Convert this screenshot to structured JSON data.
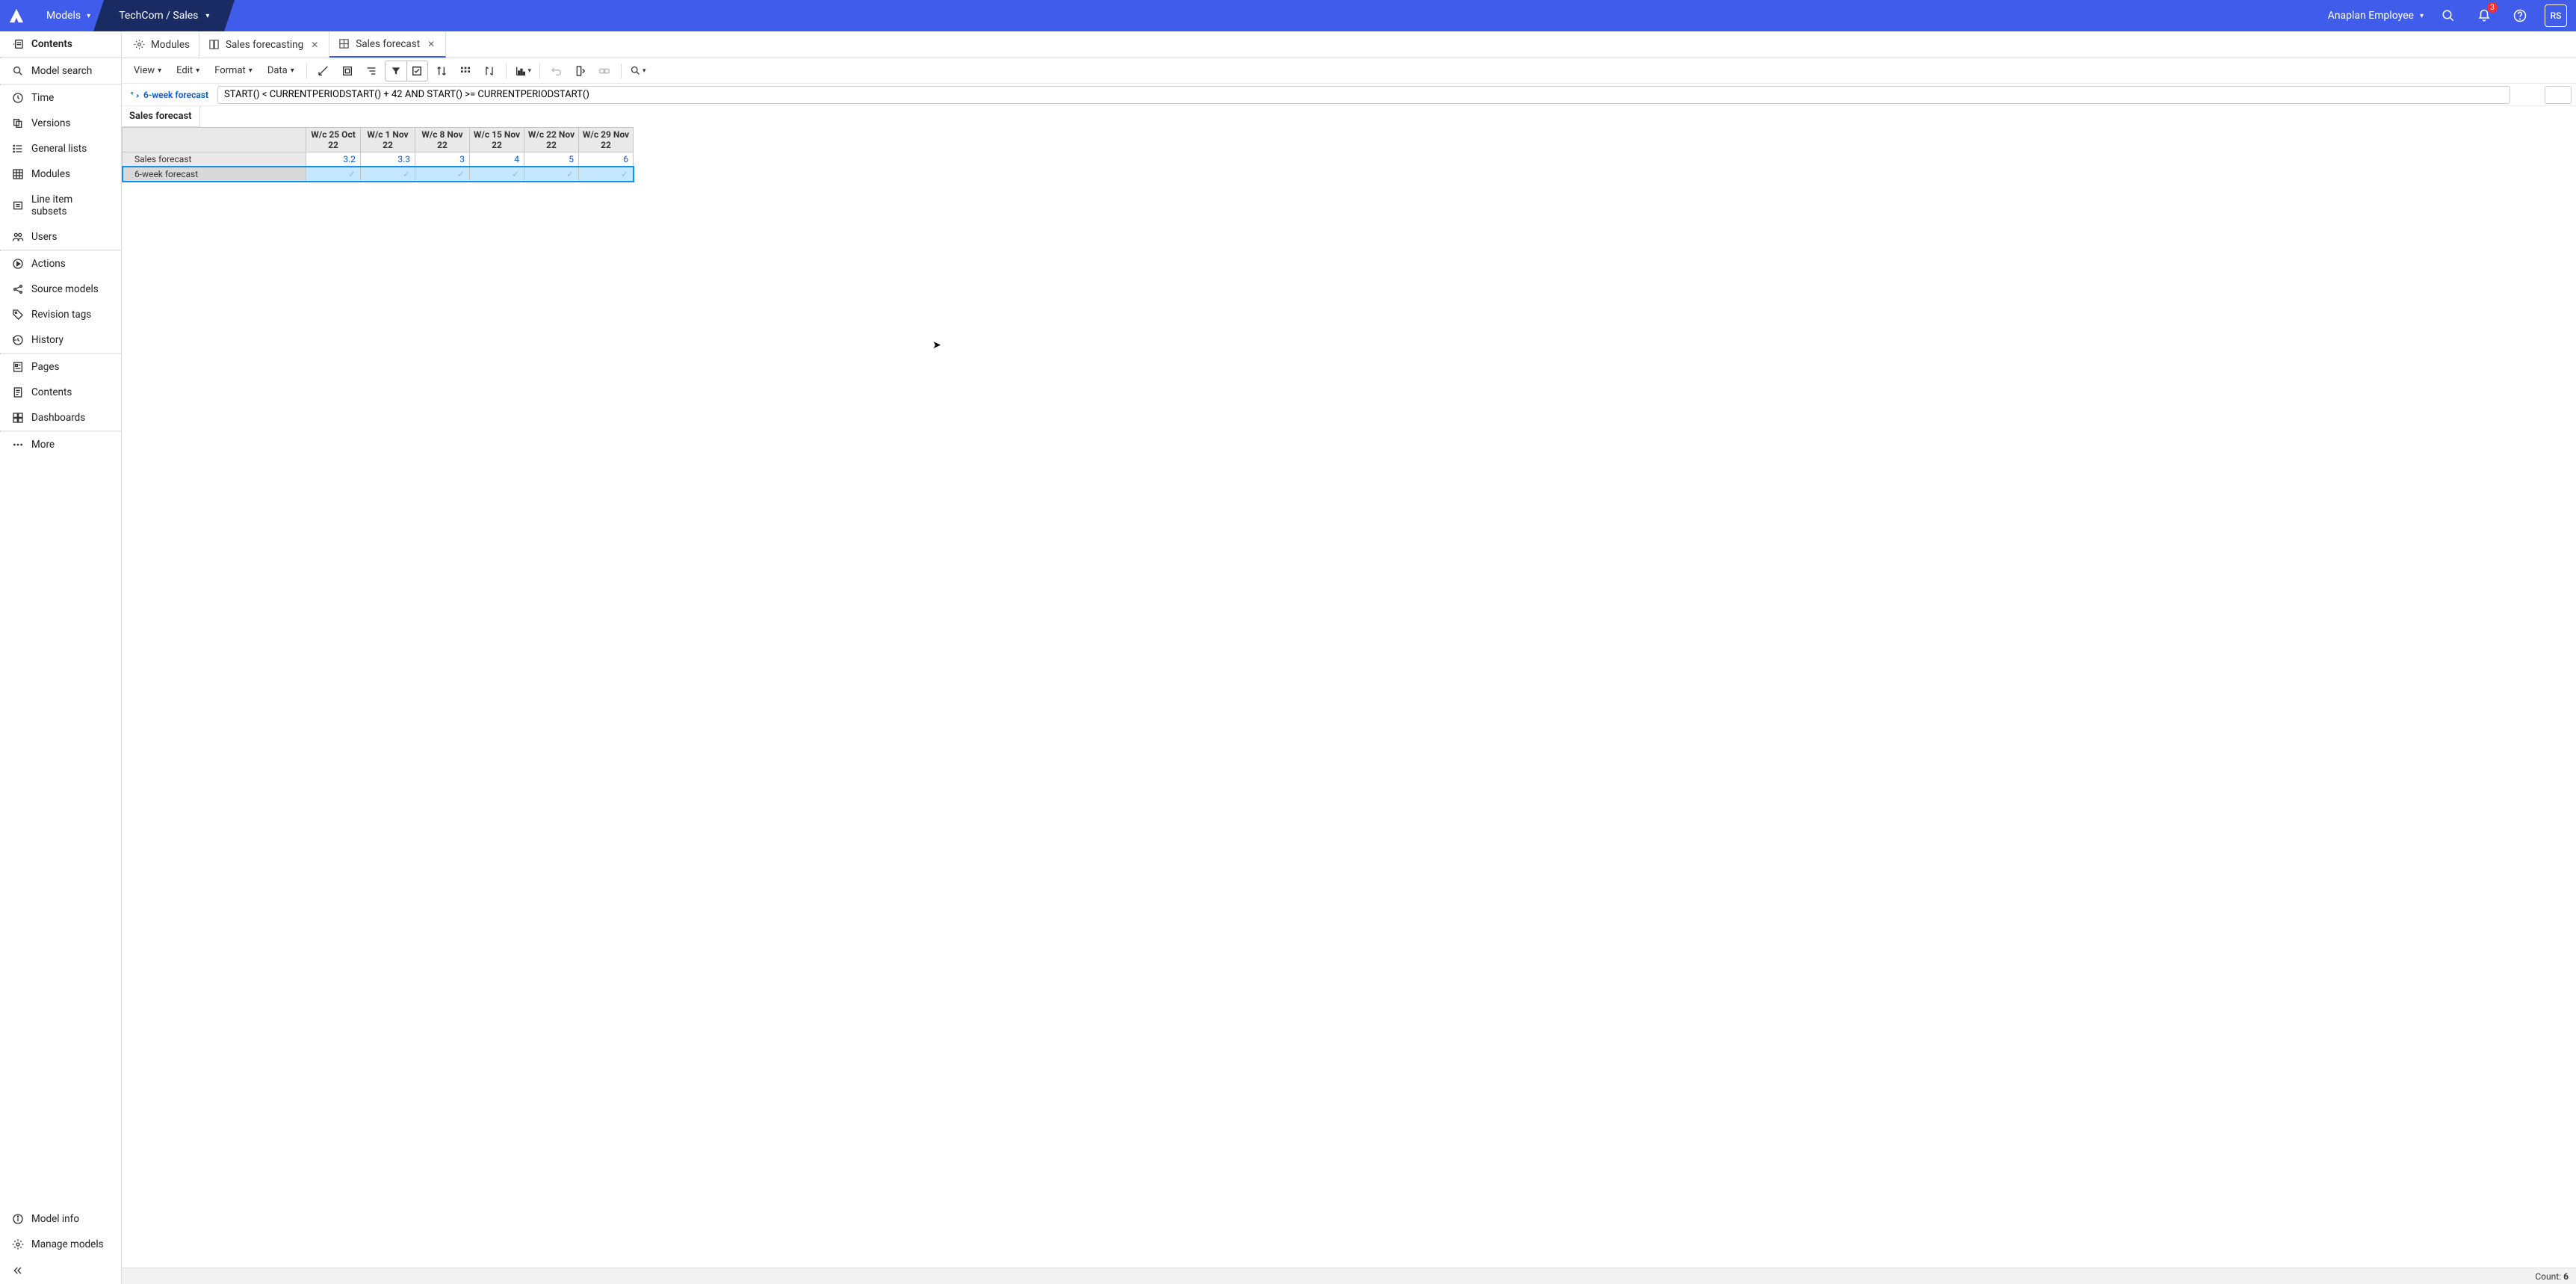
{
  "topbar": {
    "models_label": "Models",
    "workspace_label": "TechCom / Sales",
    "user_label": "Anaplan Employee",
    "notification_count": "3",
    "avatar_initials": "RS"
  },
  "sidebar": {
    "contents": "Contents",
    "model_search": "Model search",
    "group1": [
      "Time",
      "Versions",
      "General lists",
      "Modules",
      "Line item subsets",
      "Users"
    ],
    "group2": [
      "Actions",
      "Source models",
      "Revision tags",
      "History"
    ],
    "group3": [
      "Pages",
      "Contents",
      "Dashboards"
    ],
    "more": "More",
    "bottom": [
      "Model info",
      "Manage models"
    ]
  },
  "tabs": [
    {
      "label": "Modules",
      "closable": false
    },
    {
      "label": "Sales forecasting",
      "closable": true
    },
    {
      "label": "Sales forecast",
      "closable": true,
      "active": true
    }
  ],
  "toolbar": {
    "menus": [
      "View",
      "Edit",
      "Format",
      "Data"
    ]
  },
  "formula": {
    "label": "6-week forecast",
    "value": "START() < CURRENTPERIODSTART() + 42 AND START() >= CURRENTPERIODSTART()"
  },
  "sheet": {
    "title": "Sales forecast",
    "columns": [
      "W/c 25 Oct 22",
      "W/c 1 Nov 22",
      "W/c 8 Nov 22",
      "W/c 15 Nov 22",
      "W/c 22 Nov 22",
      "W/c 29 Nov 22"
    ],
    "rows": [
      {
        "label": "Sales forecast",
        "values": [
          "3.2",
          "3.3",
          "3",
          "4",
          "5",
          "6"
        ],
        "type": "num"
      },
      {
        "label": "6-week forecast",
        "values": [
          "✓",
          "✓",
          "✓",
          "✓",
          "✓",
          "✓"
        ],
        "type": "check",
        "selected": true
      }
    ]
  },
  "statusbar": {
    "count_label": "Count:",
    "count_value": "6"
  }
}
